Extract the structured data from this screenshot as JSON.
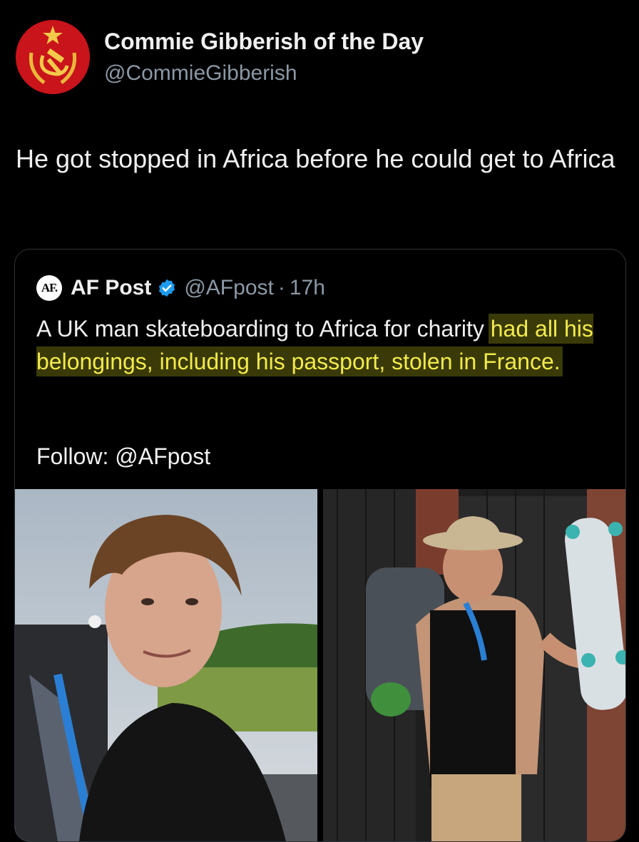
{
  "author": {
    "display_name": "Commie Gibberish of the Day",
    "handle": "@CommieGibberish",
    "avatar_icon": "hammer-sickle-star-emblem-icon"
  },
  "tweet": {
    "text": "He got stopped in Africa before he could get to Africa"
  },
  "quoted_tweet": {
    "logo_text": "AF.",
    "display_name": "AF Post",
    "verified_icon": "verified-badge-icon",
    "handle": "@AFpost",
    "separator": "·",
    "time": "17h",
    "text_plain": "A UK man skateboarding to Africa for charity ",
    "text_highlighted": "had all his belongings, including his passport, stolen in France.",
    "follow_text": "Follow: @AFpost",
    "images": [
      {
        "name": "selfie-photo",
        "description": "young man with backpack taking selfie outdoors"
      },
      {
        "name": "skateboard-photo",
        "description": "man in hat with backpack holding skateboard"
      }
    ]
  },
  "colors": {
    "background": "#000000",
    "text": "#f0f0f0",
    "secondary": "#8b98a5",
    "highlight_bg": "#3a3a08",
    "highlight_text": "#f2ea4c",
    "verified": "#1d9bf0",
    "avatar": "#c8141a"
  }
}
